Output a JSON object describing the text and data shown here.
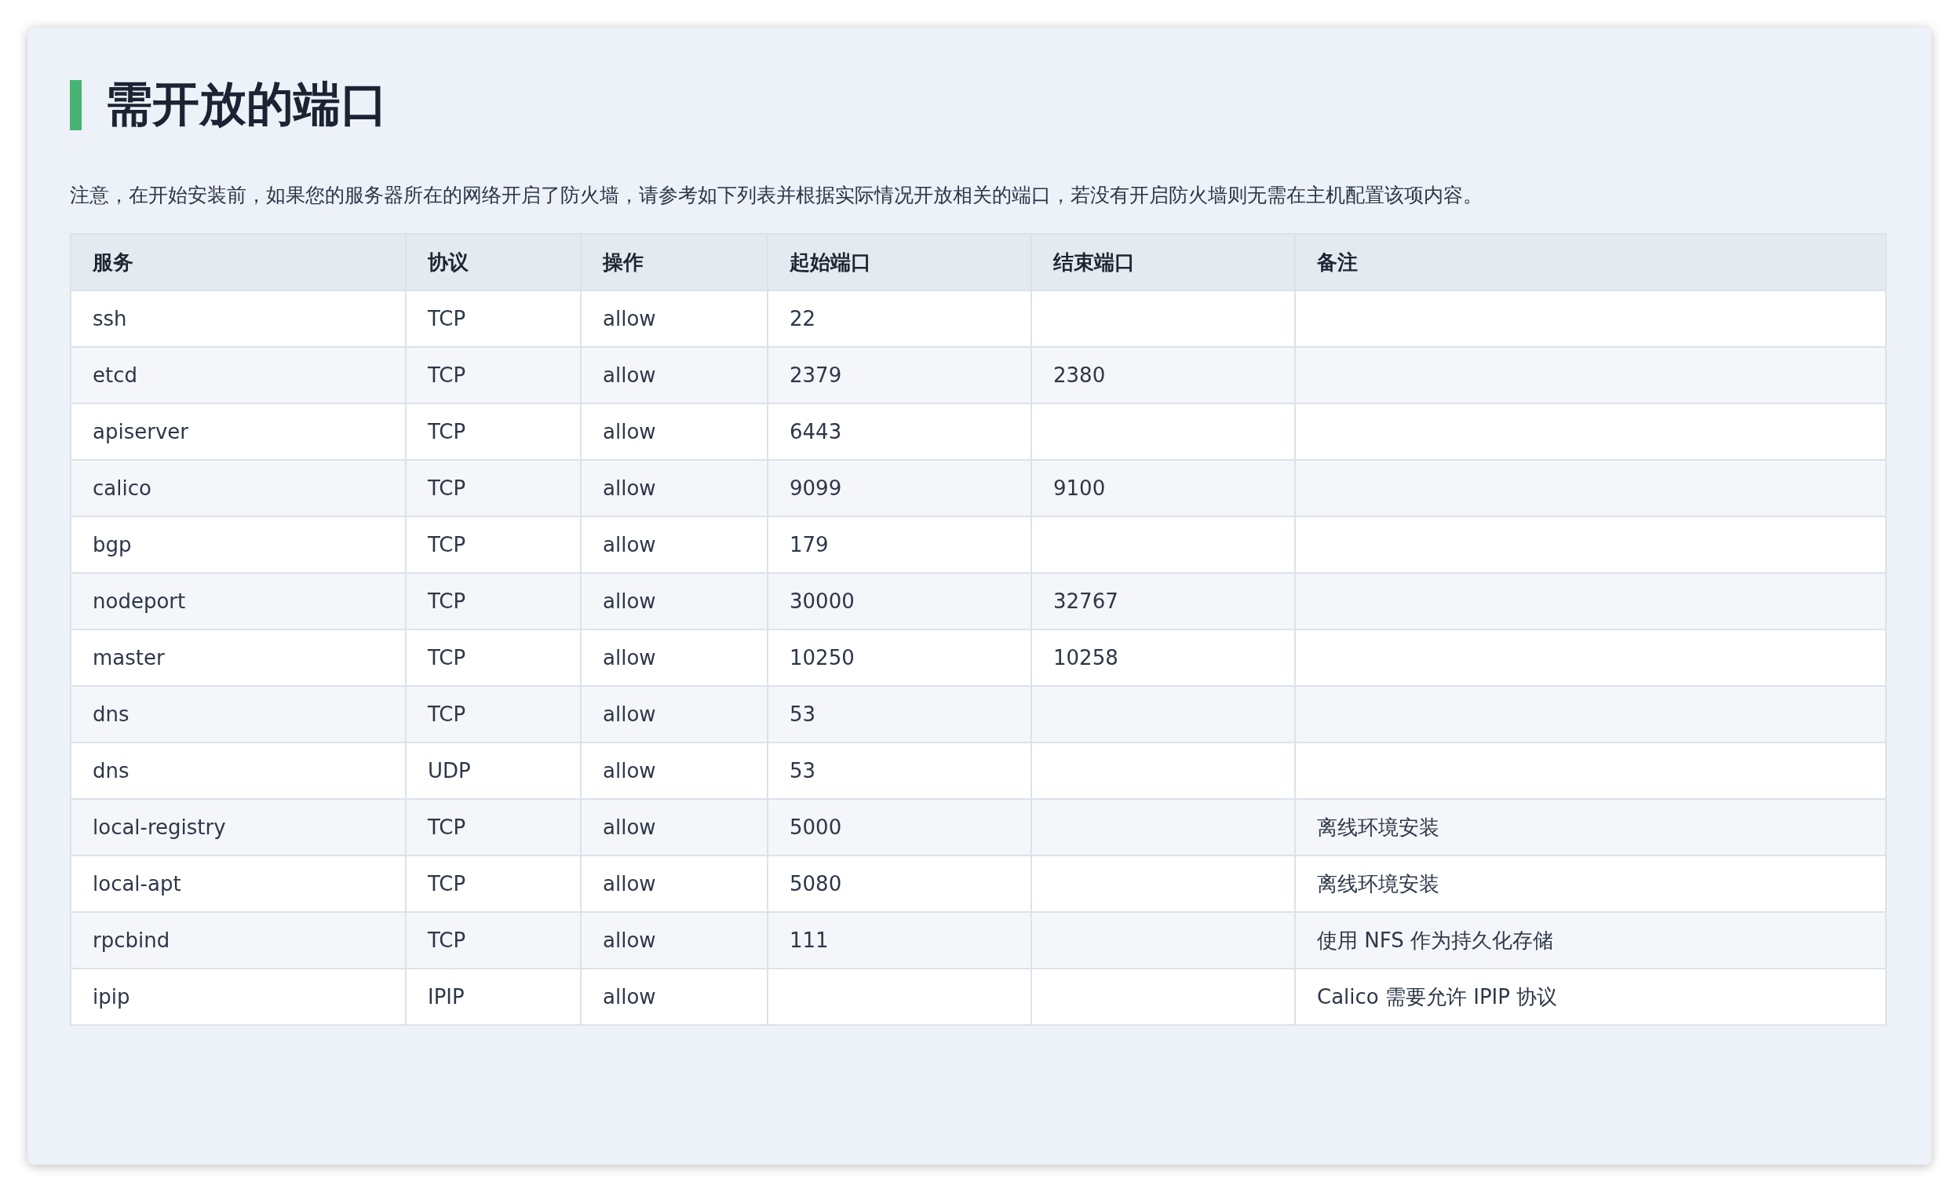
{
  "title": "需开放的端口",
  "notice": "注意，在开始安装前，如果您的服务器所在的网络开启了防火墙，请参考如下列表并根据实际情况开放相关的端口，若没有开启防火墙则无需在主机配置该项内容。",
  "table": {
    "columns": [
      "服务",
      "协议",
      "操作",
      "起始端口",
      "结束端口",
      "备注"
    ],
    "rows": [
      {
        "service": "ssh",
        "protocol": "TCP",
        "action": "allow",
        "start_port": "22"
      },
      {
        "service": "etcd",
        "protocol": "TCP",
        "action": "allow",
        "start_port": "2379",
        "end_port": "2380"
      },
      {
        "service": "apiserver",
        "protocol": "TCP",
        "action": "allow",
        "start_port": "6443"
      },
      {
        "service": "calico",
        "protocol": "TCP",
        "action": "allow",
        "start_port": "9099",
        "end_port": "9100"
      },
      {
        "service": "bgp",
        "protocol": "TCP",
        "action": "allow",
        "start_port": "179"
      },
      {
        "service": "nodeport",
        "protocol": "TCP",
        "action": "allow",
        "start_port": "30000",
        "end_port": "32767"
      },
      {
        "service": "master",
        "protocol": "TCP",
        "action": "allow",
        "start_port": "10250",
        "end_port": "10258"
      },
      {
        "service": "dns",
        "protocol": "TCP",
        "action": "allow",
        "start_port": "53"
      },
      {
        "service": "dns",
        "protocol": "UDP",
        "action": "allow",
        "start_port": "53"
      },
      {
        "service": "local-registry",
        "protocol": "TCP",
        "action": "allow",
        "start_port": "5000",
        "note": "离线环境安装"
      },
      {
        "service": "local-apt",
        "protocol": "TCP",
        "action": "allow",
        "start_port": "5080",
        "note": "离线环境安装"
      },
      {
        "service": "rpcbind",
        "protocol": "TCP",
        "action": "allow",
        "start_port": "111",
        "note": "使用 NFS 作为持久化存储"
      },
      {
        "service": "ipip",
        "protocol": "IPIP",
        "action": "allow",
        "note": "Calico 需要允许 IPIP 协议"
      }
    ]
  }
}
